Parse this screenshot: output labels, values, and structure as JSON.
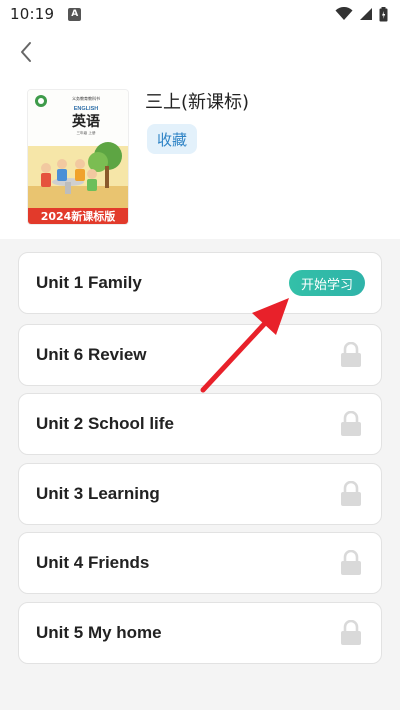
{
  "status_bar": {
    "time": "10:19",
    "notification_icon": "a-badge-icon",
    "notification_glyph": "A"
  },
  "header": {
    "back_icon": "chevron-left-icon"
  },
  "book": {
    "title": "三上(新课标)",
    "favorite_label": "收藏",
    "cover": {
      "publisher_line": "义务教育教科书",
      "subject_en": "ENGLISH",
      "subject_cn": "英语",
      "grade_line": "三年级 上册",
      "edition_banner": "2024新课标版"
    }
  },
  "units": [
    {
      "label": "Unit 1 Family",
      "action": "开始学习",
      "locked": false
    },
    {
      "label": "Unit 6 Review",
      "locked": true
    },
    {
      "label": "Unit 2 School life",
      "locked": true
    },
    {
      "label": "Unit 3 Learning",
      "locked": true
    },
    {
      "label": "Unit 4 Friends",
      "locked": true
    },
    {
      "label": "Unit 5 My home",
      "locked": true
    }
  ],
  "colors": {
    "accent_teal": "#33c0a8",
    "favorite_bg": "#e3f1fb",
    "favorite_text": "#2f84c6",
    "annotation_arrow": "#e8212a",
    "lock_gray": "#d9d9d9"
  }
}
